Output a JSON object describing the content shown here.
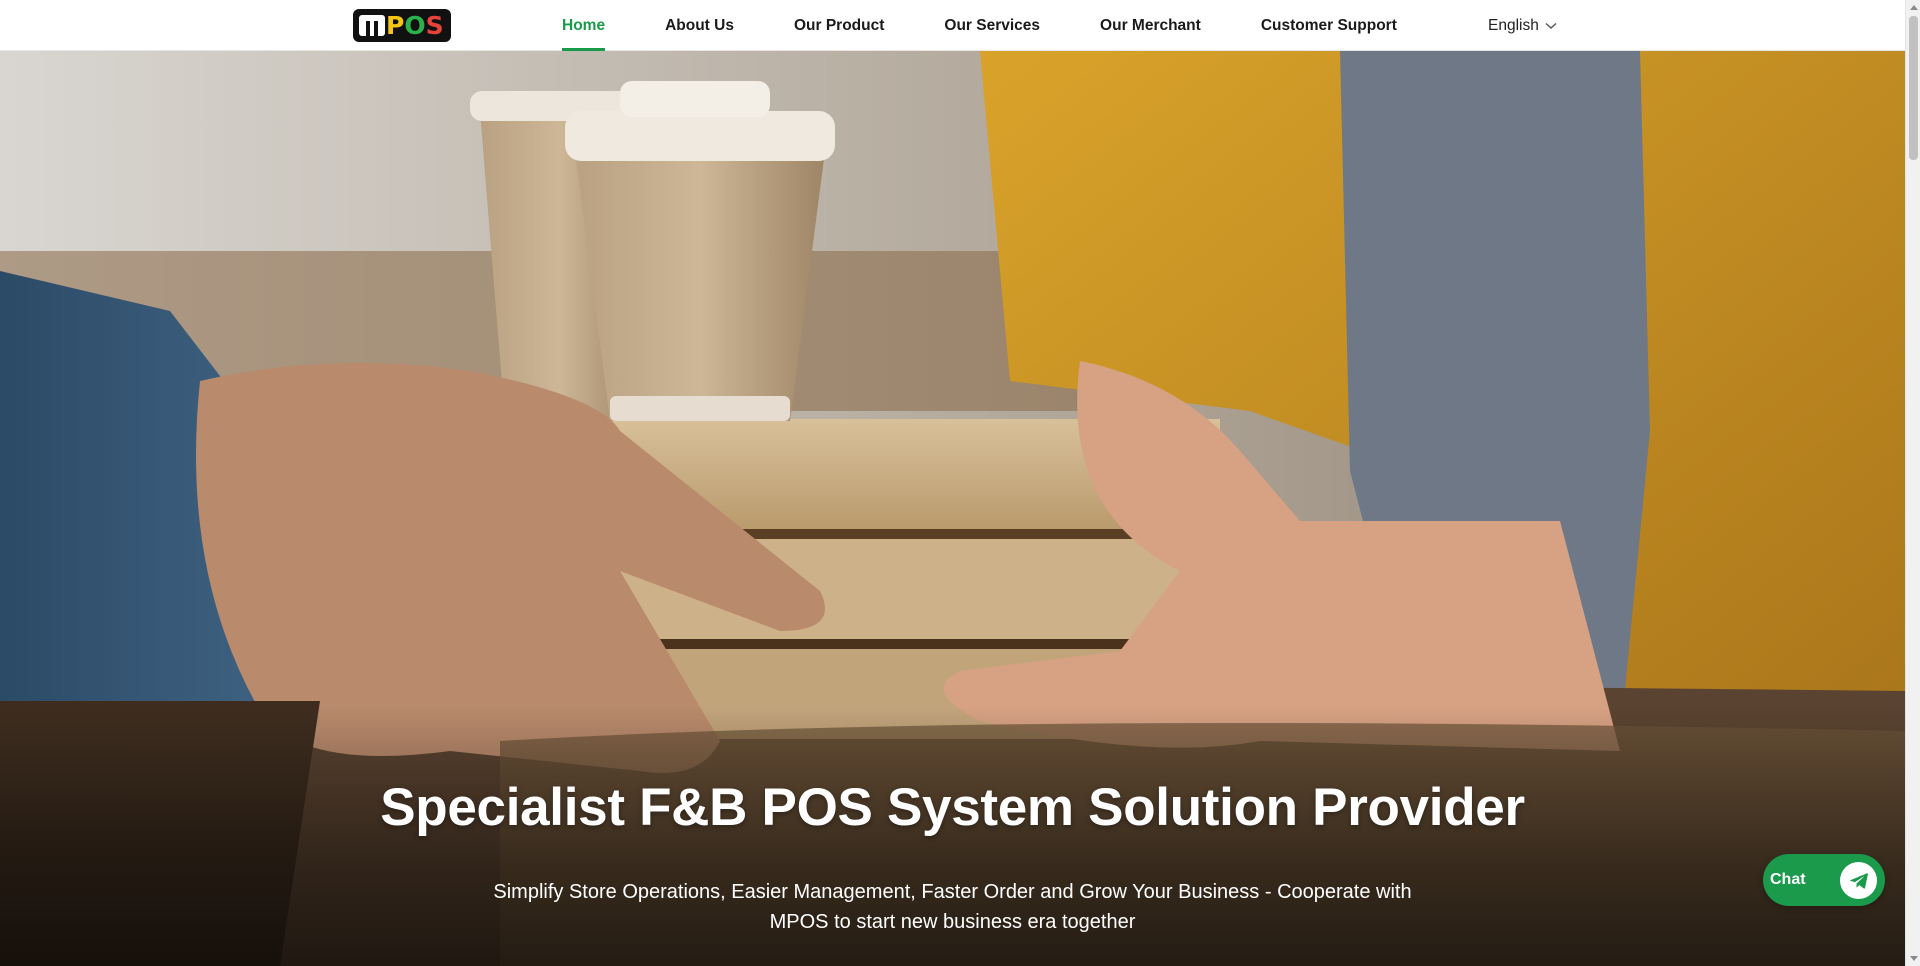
{
  "brand": {
    "logo_text": "MPOS",
    "logo_letters": {
      "p": "P",
      "o": "O",
      "s": "S"
    }
  },
  "nav": {
    "items": [
      {
        "label": "Home",
        "active": true
      },
      {
        "label": "About Us",
        "active": false
      },
      {
        "label": "Our Product",
        "active": false
      },
      {
        "label": "Our Services",
        "active": false
      },
      {
        "label": "Our Merchant",
        "active": false
      },
      {
        "label": "Customer Support",
        "active": false
      }
    ],
    "active_color": "#189a48"
  },
  "language": {
    "selected": "English",
    "icon": "chevron-down-icon"
  },
  "hero": {
    "title": "Specialist F&B POS System Solution Provider",
    "subtitle": "Simplify Store Operations, Easier Management, Faster Order and Grow Your Business - Cooperate with MPOS to start new business era together",
    "image_subject": "hero-background-photo"
  },
  "chat": {
    "label": "Chat",
    "icon": "send-icon",
    "color": "#1a9a4a"
  }
}
